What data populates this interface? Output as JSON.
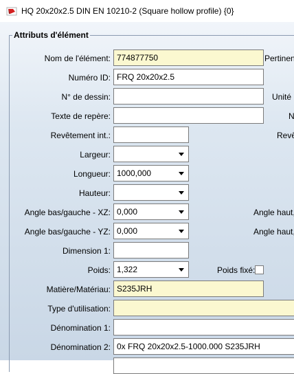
{
  "window": {
    "title": "HQ 20x20x2.5 DIN EN 10210-2 (Square hollow profile) {0}",
    "icon": "hicad-part-icon"
  },
  "group": {
    "legend": "Attributs d'élément"
  },
  "fields": {
    "nom_element": {
      "label": "Nom de l'élément:",
      "value": "774877750"
    },
    "numero_id": {
      "label": "Numéro ID:",
      "value": "FRQ 20x20x2.5"
    },
    "no_dessin": {
      "label": "N° de dessin:",
      "value": ""
    },
    "texte_repere": {
      "label": "Texte de repère:",
      "value": ""
    },
    "revetement_int": {
      "label": "Revêtement int.:",
      "value": ""
    },
    "largeur": {
      "label": "Largeur:",
      "value": ""
    },
    "longueur": {
      "label": "Longueur:",
      "value": "1000,000"
    },
    "hauteur": {
      "label": "Hauteur:",
      "value": ""
    },
    "angle_xz": {
      "label": "Angle bas/gauche - XZ:",
      "value": "0,000"
    },
    "angle_yz": {
      "label": "Angle bas/gauche - YZ:",
      "value": "0,000"
    },
    "dimension1": {
      "label": "Dimension 1:",
      "value": ""
    },
    "poids": {
      "label": "Poids:",
      "value": "1,322"
    },
    "matiere": {
      "label": "Matière/Matériau:",
      "value": "S235JRH"
    },
    "type_utilisation": {
      "label": "Type d'utilisation:",
      "value": ""
    },
    "denomination1": {
      "label": "Dénomination 1:",
      "value": ""
    },
    "denomination2": {
      "label": "Dénomination 2:",
      "value": "0x FRQ 20x20x2.5-1000.000 S235JRH"
    }
  },
  "right_column": {
    "pertinence": "Pertinen",
    "unite": "Unité",
    "n": "N",
    "revetement_ext": "Revê",
    "angle_haut_xz": "Angle haut,",
    "angle_haut_yz": "Angle haut,",
    "poids_fixe": "Poids fixé:"
  }
}
